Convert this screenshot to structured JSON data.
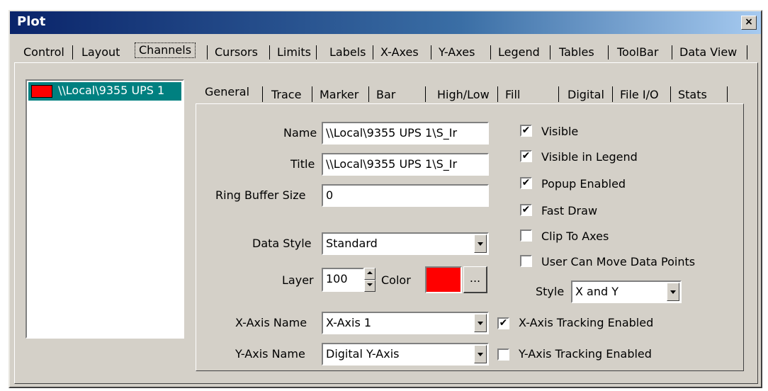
{
  "window": {
    "title": "Plot",
    "close_glyph": "×"
  },
  "main_tabs": [
    "Control",
    "Layout",
    "Channels",
    "Cursors",
    "Limits",
    "Labels",
    "X-Axes",
    "Y-Axes",
    "Legend",
    "Tables",
    "ToolBar",
    "Data View"
  ],
  "main_tab_selected": "Channels",
  "channel_list": [
    {
      "label": "\\\\Local\\9355 UPS 1",
      "color": "#ff0000"
    }
  ],
  "sub_tabs": [
    "General",
    "Trace",
    "Marker",
    "Bar",
    "High/Low",
    "Fill",
    "Digital",
    "File I/O",
    "Stats"
  ],
  "sub_tab_selected": "General",
  "general": {
    "name_label": "Name",
    "name_value": "\\\\Local\\9355 UPS 1\\S_Ir",
    "title_label": "Title",
    "title_value": "\\\\Local\\9355 UPS 1\\S_Ir",
    "ring_buffer_label": "Ring Buffer Size",
    "ring_buffer_value": "0",
    "data_style_label": "Data Style",
    "data_style_value": "Standard",
    "layer_label": "Layer",
    "layer_value": "100",
    "color_label": "Color",
    "color_value": "#ff0000",
    "ellipsis_label": "...",
    "xaxis_label": "X-Axis Name",
    "xaxis_value": "X-Axis 1",
    "yaxis_label": "Y-Axis Name",
    "yaxis_value": "Digital Y-Axis",
    "style_label": "Style",
    "style_value": "X and Y"
  },
  "checkboxes": [
    {
      "label": "Visible",
      "checked": true
    },
    {
      "label": "Visible in Legend",
      "checked": true
    },
    {
      "label": "Popup Enabled",
      "checked": true
    },
    {
      "label": "Fast Draw",
      "checked": true
    },
    {
      "label": "Clip To Axes",
      "checked": false
    },
    {
      "label": "User Can Move Data Points",
      "checked": false
    }
  ],
  "tracking": [
    {
      "label": "X-Axis Tracking Enabled",
      "checked": true
    },
    {
      "label": "Y-Axis Tracking Enabled",
      "checked": false
    }
  ],
  "check_glyph": "✔"
}
